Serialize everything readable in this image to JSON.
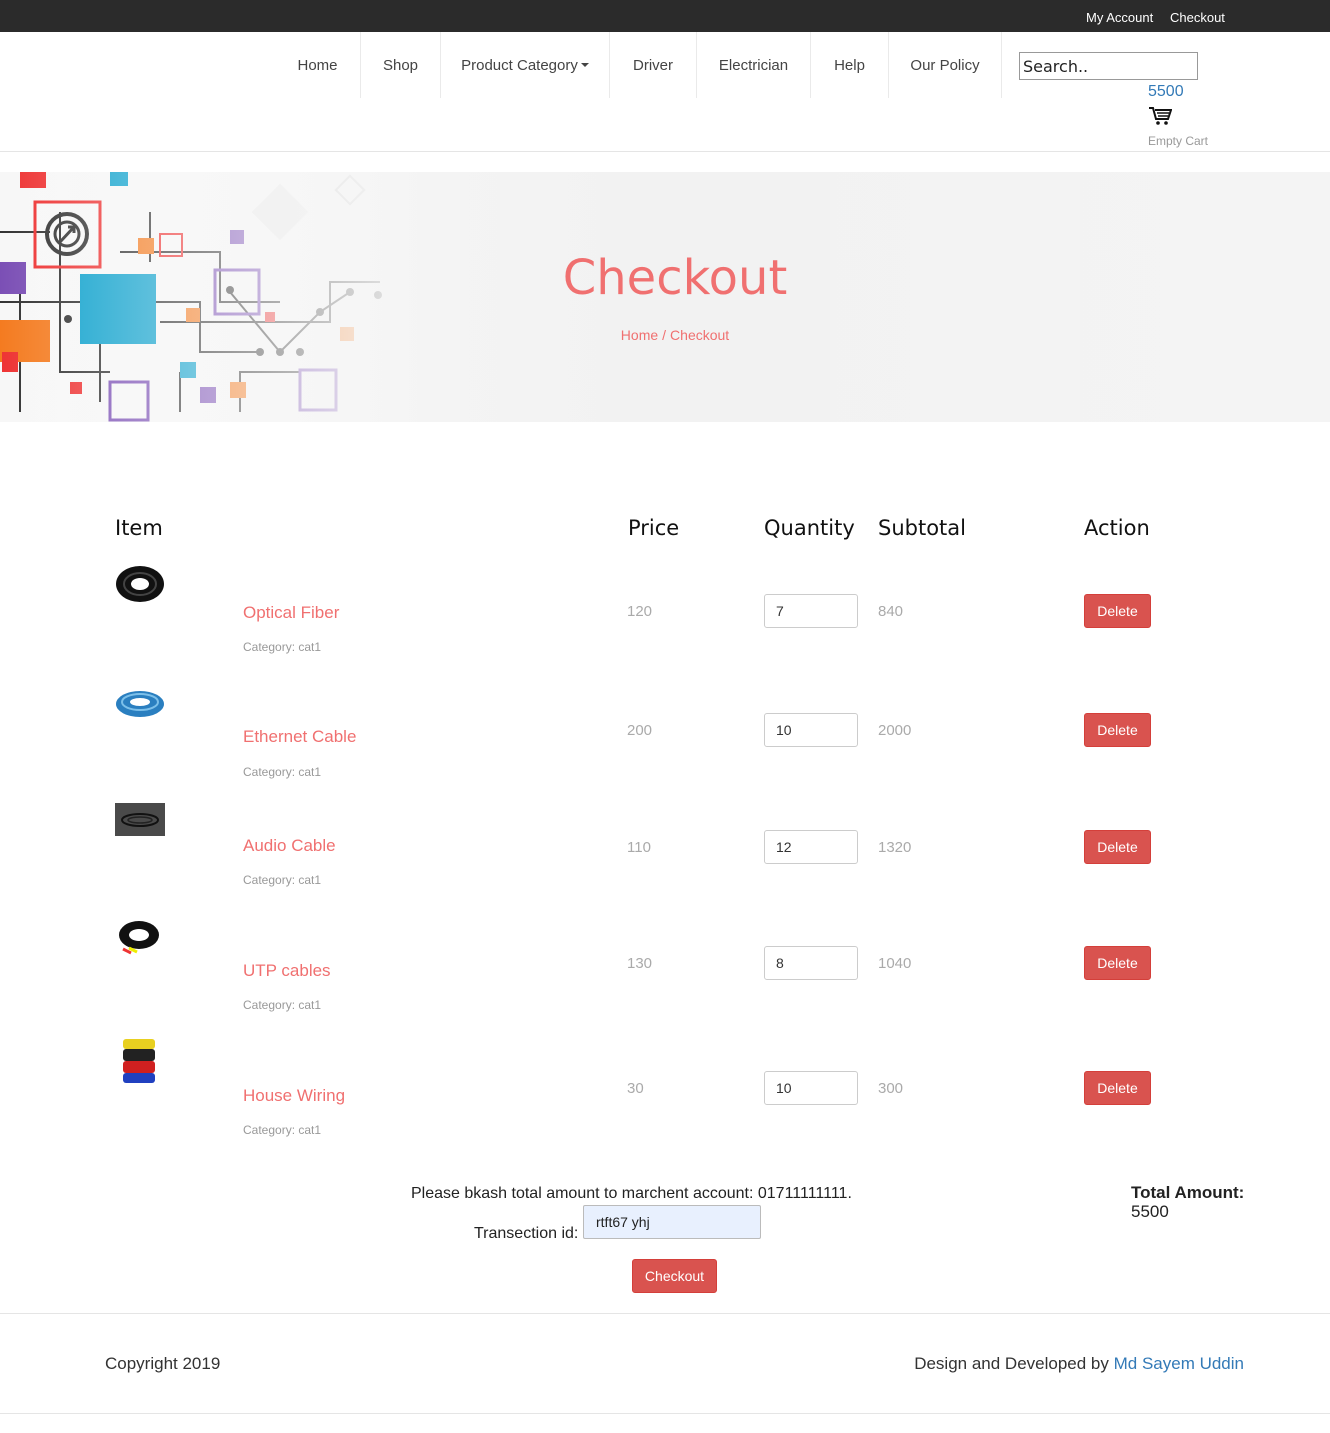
{
  "topbar": {
    "my_account": "My Account",
    "checkout": "Checkout"
  },
  "nav": {
    "items": [
      {
        "label": "Home"
      },
      {
        "label": "Shop"
      },
      {
        "label": "Product Category"
      },
      {
        "label": "Driver"
      },
      {
        "label": "Electrician"
      },
      {
        "label": "Help"
      },
      {
        "label": "Our Policy"
      }
    ],
    "search_placeholder": "Search..",
    "cart_amount": "5500",
    "cart_label": "Empty Cart"
  },
  "banner": {
    "title": "Checkout",
    "breadcrumb": [
      "Home",
      "Checkout"
    ]
  },
  "table": {
    "headers": {
      "item": "Item",
      "price": "Price",
      "quantity": "Quantity",
      "subtotal": "Subtotal",
      "action": "Action"
    },
    "rows": [
      {
        "name": "Optical Fiber",
        "category": "Category: cat1",
        "price": "120",
        "quantity": "7",
        "subtotal": "840",
        "action": "Delete"
      },
      {
        "name": "Ethernet Cable",
        "category": "Category: cat1",
        "price": "200",
        "quantity": "10",
        "subtotal": "2000",
        "action": "Delete"
      },
      {
        "name": "Audio Cable",
        "category": "Category: cat1",
        "price": "110",
        "quantity": "12",
        "subtotal": "1320",
        "action": "Delete"
      },
      {
        "name": "UTP cables",
        "category": "Category: cat1",
        "price": "130",
        "quantity": "8",
        "subtotal": "1040",
        "action": "Delete"
      },
      {
        "name": "House Wiring",
        "category": "Category: cat1",
        "price": "30",
        "quantity": "10",
        "subtotal": "300",
        "action": "Delete"
      }
    ]
  },
  "payment": {
    "note": "Please bkash total amount to marchent account: 01711111111.",
    "transaction_label": "Transection id:",
    "transaction_value": "rtft67 yhj",
    "total_label": "Total Amount:",
    "total_value": "5500",
    "checkout_label": "Checkout"
  },
  "footer": {
    "copyright": "Copyright 2019",
    "credit_prefix": "Design and Developed by",
    "credit_name": "Md Sayem Uddin"
  },
  "colors": {
    "accent": "#f07070",
    "danger": "#d9534f",
    "link": "#337ab7",
    "topbar": "#2b2b2b"
  }
}
